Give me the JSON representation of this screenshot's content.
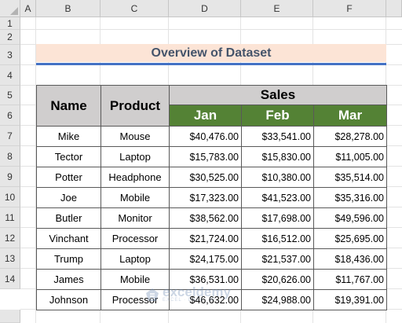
{
  "column_headers": [
    "A",
    "B",
    "C",
    "D",
    "E",
    "F"
  ],
  "row_headers": [
    "1",
    "2",
    "3",
    "4",
    "5",
    "6",
    "7",
    "8",
    "9",
    "10",
    "11",
    "12",
    "13",
    "14"
  ],
  "title": "Overview of Dataset",
  "table": {
    "name_header": "Name",
    "product_header": "Product",
    "sales_header": "Sales",
    "months": [
      "Jan",
      "Feb",
      "Mar"
    ],
    "rows": [
      {
        "name": "Mike",
        "product": "Mouse",
        "jan": "$40,476.00",
        "feb": "$33,541.00",
        "mar": "$28,278.00"
      },
      {
        "name": "Tector",
        "product": "Laptop",
        "jan": "$15,783.00",
        "feb": "$15,830.00",
        "mar": "$11,005.00"
      },
      {
        "name": "Potter",
        "product": "Headphone",
        "jan": "$30,525.00",
        "feb": "$10,380.00",
        "mar": "$35,514.00"
      },
      {
        "name": "Joe",
        "product": "Mobile",
        "jan": "$17,323.00",
        "feb": "$41,523.00",
        "mar": "$35,316.00"
      },
      {
        "name": "Butler",
        "product": "Monitor",
        "jan": "$38,562.00",
        "feb": "$17,698.00",
        "mar": "$49,596.00"
      },
      {
        "name": "Vinchant",
        "product": "Processor",
        "jan": "$21,724.00",
        "feb": "$16,512.00",
        "mar": "$25,695.00"
      },
      {
        "name": "Trump",
        "product": "Laptop",
        "jan": "$24,175.00",
        "feb": "$21,537.00",
        "mar": "$18,436.00"
      },
      {
        "name": "James",
        "product": "Mobile",
        "jan": "$36,531.00",
        "feb": "$20,626.00",
        "mar": "$11,767.00"
      },
      {
        "name": "Johnson",
        "product": "Processor",
        "jan": "$46,632.00",
        "feb": "$24,988.00",
        "mar": "$19,391.00"
      }
    ]
  },
  "watermark": {
    "name": "exceldemy",
    "tagline": "EXCEL · DATA · BI"
  },
  "colors": {
    "title_fill": "#fce4d6",
    "title_text": "#44546a",
    "title_underline": "#4472c4",
    "header_gray": "#d0cece",
    "header_green": "#548235"
  }
}
